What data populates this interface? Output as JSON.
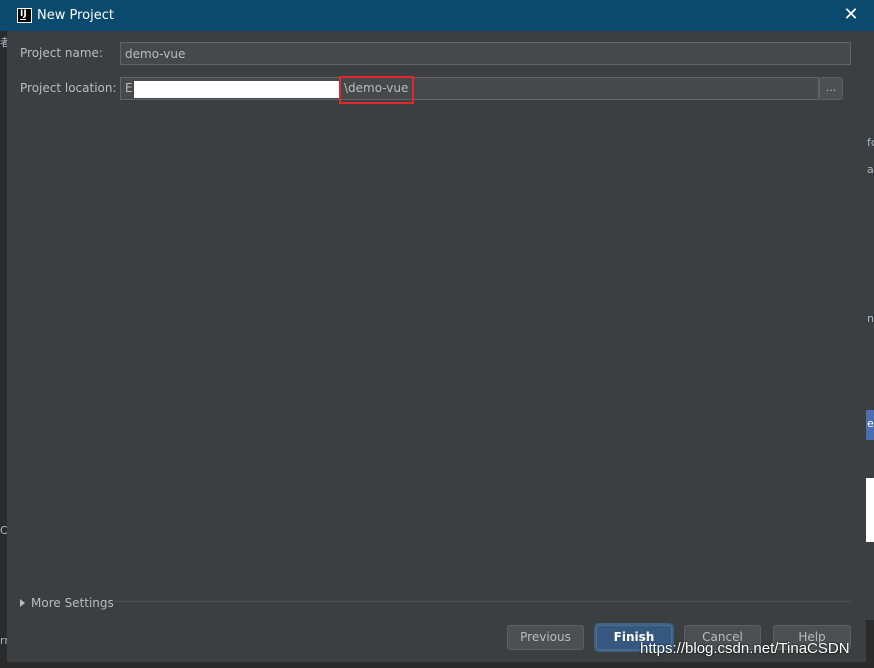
{
  "window": {
    "title": "New Project"
  },
  "form": {
    "project_name_label": "Project name:",
    "project_name_value": "demo-vue",
    "project_location_label": "Project location:",
    "project_location_prefix": "E",
    "project_location_suffix": "\\demo-vue",
    "browse_label": "..."
  },
  "more_settings": {
    "label": "More Settings"
  },
  "buttons": {
    "previous": "Previous",
    "finish": "Finish",
    "cancel": "Cancel",
    "help": "Help"
  },
  "watermark": {
    "text": "https://blog.csdn.net/TinaCSDN"
  },
  "background": {
    "left_fragments": [
      "者",
      "C",
      "rr"
    ],
    "right_fragments": [
      "fc",
      "a",
      "n",
      "e"
    ]
  },
  "colors": {
    "titlebar": "#0b4a6e",
    "dialog_bg": "#3c3f41",
    "field_bg": "#45494a",
    "highlight": "#e0282e",
    "primary_button": "#365880"
  },
  "icons": {
    "app": "intellij-idea-icon",
    "close": "close-icon",
    "expand": "triangle-right-icon"
  }
}
